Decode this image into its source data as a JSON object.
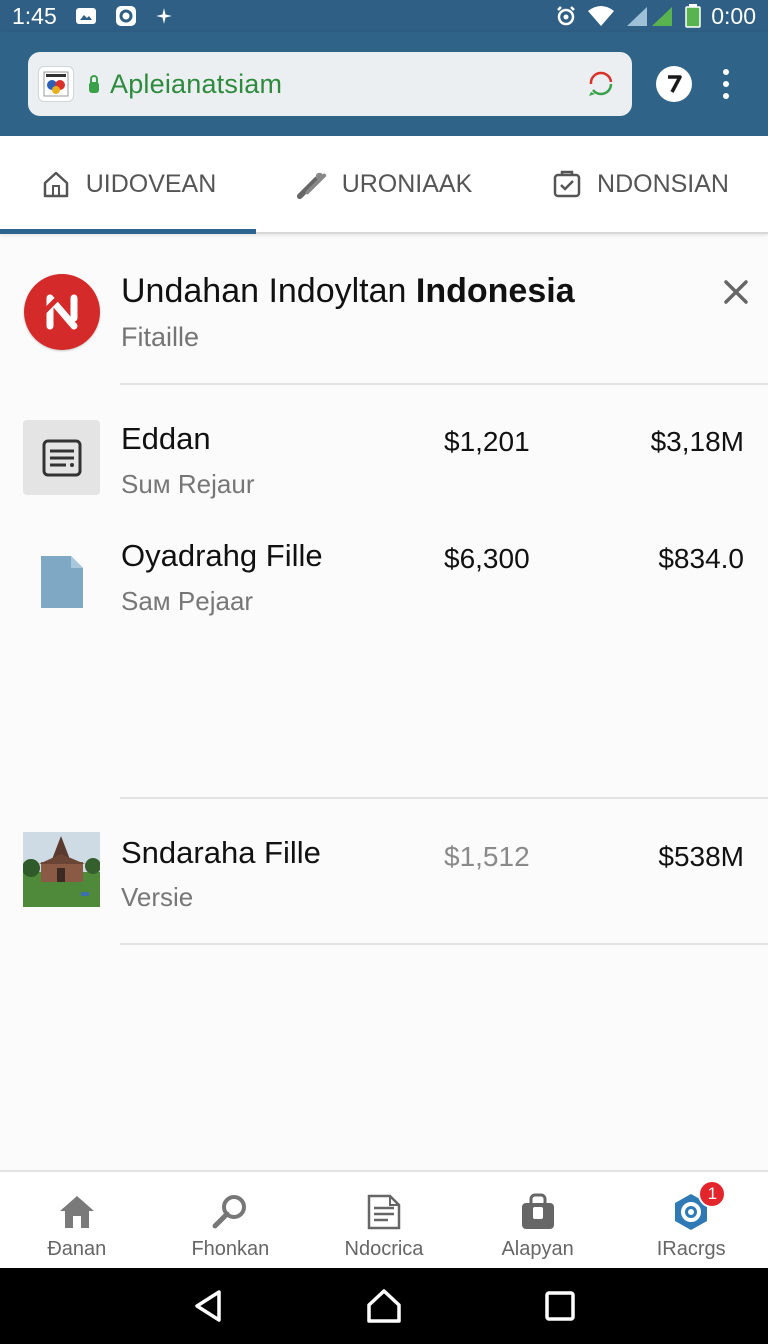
{
  "status_bar": {
    "time_left": "1:45",
    "time_right": "0:00"
  },
  "browser": {
    "url": "Apleianatsiam"
  },
  "tabs": [
    {
      "label": "UIDOVEAN",
      "icon": "home-icon",
      "active": true
    },
    {
      "label": "URONIAAK",
      "icon": "wrench-icon",
      "active": false
    },
    {
      "label": "NDONSIAN",
      "icon": "clipboard-icon",
      "active": false
    }
  ],
  "header": {
    "title_regular": "Undahan Indoyltan ",
    "title_bold": "Indonesia",
    "subtitle": "Fitaille",
    "logo_color": "#d42a2a"
  },
  "rows": [
    {
      "title": "Eddan",
      "subtitle": "Suм Rejaur",
      "value1": "$1,201",
      "value2": "$3,18M",
      "thumb": "document-list-icon"
    },
    {
      "title": "Oуadrahg Fille",
      "subtitle": "Saм Pejaar",
      "value1": "$6,300",
      "value2": "$834.0",
      "thumb": "file-icon"
    },
    {
      "title": "Sndaraha Fille",
      "subtitle": "Versie",
      "value1": "$1,512",
      "value2": "$538M",
      "thumb": "temple-photo"
    }
  ],
  "bottom_nav": [
    {
      "label": "Đanan",
      "icon": "home-icon"
    },
    {
      "label": "Fhonkan",
      "icon": "search-icon"
    },
    {
      "label": "Ndocrica",
      "icon": "document-icon"
    },
    {
      "label": "Alapyan",
      "icon": "bag-icon"
    },
    {
      "label": "IRacrgs",
      "icon": "hexagon-icon",
      "badge": "1"
    }
  ],
  "colors": {
    "toolbar": "#2f6488",
    "accent": "#2d6590",
    "url_green": "#2e8b3e",
    "badge_red": "#e3262b"
  }
}
